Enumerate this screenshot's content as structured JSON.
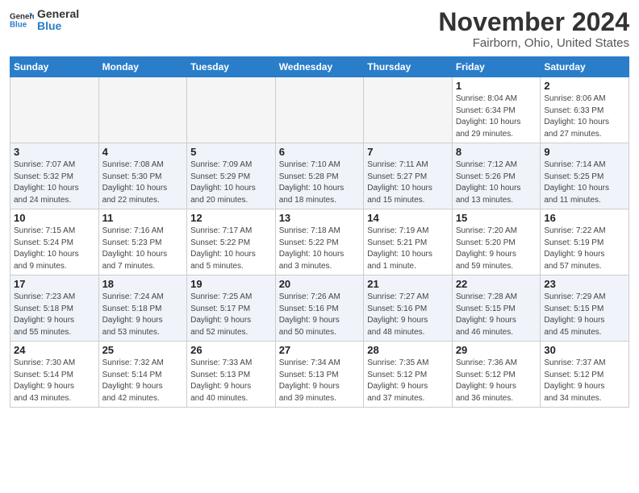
{
  "logo": {
    "line1": "General",
    "line2": "Blue"
  },
  "title": "November 2024",
  "location": "Fairborn, Ohio, United States",
  "days_header": [
    "Sunday",
    "Monday",
    "Tuesday",
    "Wednesday",
    "Thursday",
    "Friday",
    "Saturday"
  ],
  "weeks": [
    [
      {
        "day": "",
        "info": ""
      },
      {
        "day": "",
        "info": ""
      },
      {
        "day": "",
        "info": ""
      },
      {
        "day": "",
        "info": ""
      },
      {
        "day": "",
        "info": ""
      },
      {
        "day": "1",
        "info": "Sunrise: 8:04 AM\nSunset: 6:34 PM\nDaylight: 10 hours\nand 29 minutes."
      },
      {
        "day": "2",
        "info": "Sunrise: 8:06 AM\nSunset: 6:33 PM\nDaylight: 10 hours\nand 27 minutes."
      }
    ],
    [
      {
        "day": "3",
        "info": "Sunrise: 7:07 AM\nSunset: 5:32 PM\nDaylight: 10 hours\nand 24 minutes."
      },
      {
        "day": "4",
        "info": "Sunrise: 7:08 AM\nSunset: 5:30 PM\nDaylight: 10 hours\nand 22 minutes."
      },
      {
        "day": "5",
        "info": "Sunrise: 7:09 AM\nSunset: 5:29 PM\nDaylight: 10 hours\nand 20 minutes."
      },
      {
        "day": "6",
        "info": "Sunrise: 7:10 AM\nSunset: 5:28 PM\nDaylight: 10 hours\nand 18 minutes."
      },
      {
        "day": "7",
        "info": "Sunrise: 7:11 AM\nSunset: 5:27 PM\nDaylight: 10 hours\nand 15 minutes."
      },
      {
        "day": "8",
        "info": "Sunrise: 7:12 AM\nSunset: 5:26 PM\nDaylight: 10 hours\nand 13 minutes."
      },
      {
        "day": "9",
        "info": "Sunrise: 7:14 AM\nSunset: 5:25 PM\nDaylight: 10 hours\nand 11 minutes."
      }
    ],
    [
      {
        "day": "10",
        "info": "Sunrise: 7:15 AM\nSunset: 5:24 PM\nDaylight: 10 hours\nand 9 minutes."
      },
      {
        "day": "11",
        "info": "Sunrise: 7:16 AM\nSunset: 5:23 PM\nDaylight: 10 hours\nand 7 minutes."
      },
      {
        "day": "12",
        "info": "Sunrise: 7:17 AM\nSunset: 5:22 PM\nDaylight: 10 hours\nand 5 minutes."
      },
      {
        "day": "13",
        "info": "Sunrise: 7:18 AM\nSunset: 5:22 PM\nDaylight: 10 hours\nand 3 minutes."
      },
      {
        "day": "14",
        "info": "Sunrise: 7:19 AM\nSunset: 5:21 PM\nDaylight: 10 hours\nand 1 minute."
      },
      {
        "day": "15",
        "info": "Sunrise: 7:20 AM\nSunset: 5:20 PM\nDaylight: 9 hours\nand 59 minutes."
      },
      {
        "day": "16",
        "info": "Sunrise: 7:22 AM\nSunset: 5:19 PM\nDaylight: 9 hours\nand 57 minutes."
      }
    ],
    [
      {
        "day": "17",
        "info": "Sunrise: 7:23 AM\nSunset: 5:18 PM\nDaylight: 9 hours\nand 55 minutes."
      },
      {
        "day": "18",
        "info": "Sunrise: 7:24 AM\nSunset: 5:18 PM\nDaylight: 9 hours\nand 53 minutes."
      },
      {
        "day": "19",
        "info": "Sunrise: 7:25 AM\nSunset: 5:17 PM\nDaylight: 9 hours\nand 52 minutes."
      },
      {
        "day": "20",
        "info": "Sunrise: 7:26 AM\nSunset: 5:16 PM\nDaylight: 9 hours\nand 50 minutes."
      },
      {
        "day": "21",
        "info": "Sunrise: 7:27 AM\nSunset: 5:16 PM\nDaylight: 9 hours\nand 48 minutes."
      },
      {
        "day": "22",
        "info": "Sunrise: 7:28 AM\nSunset: 5:15 PM\nDaylight: 9 hours\nand 46 minutes."
      },
      {
        "day": "23",
        "info": "Sunrise: 7:29 AM\nSunset: 5:15 PM\nDaylight: 9 hours\nand 45 minutes."
      }
    ],
    [
      {
        "day": "24",
        "info": "Sunrise: 7:30 AM\nSunset: 5:14 PM\nDaylight: 9 hours\nand 43 minutes."
      },
      {
        "day": "25",
        "info": "Sunrise: 7:32 AM\nSunset: 5:14 PM\nDaylight: 9 hours\nand 42 minutes."
      },
      {
        "day": "26",
        "info": "Sunrise: 7:33 AM\nSunset: 5:13 PM\nDaylight: 9 hours\nand 40 minutes."
      },
      {
        "day": "27",
        "info": "Sunrise: 7:34 AM\nSunset: 5:13 PM\nDaylight: 9 hours\nand 39 minutes."
      },
      {
        "day": "28",
        "info": "Sunrise: 7:35 AM\nSunset: 5:12 PM\nDaylight: 9 hours\nand 37 minutes."
      },
      {
        "day": "29",
        "info": "Sunrise: 7:36 AM\nSunset: 5:12 PM\nDaylight: 9 hours\nand 36 minutes."
      },
      {
        "day": "30",
        "info": "Sunrise: 7:37 AM\nSunset: 5:12 PM\nDaylight: 9 hours\nand 34 minutes."
      }
    ]
  ]
}
